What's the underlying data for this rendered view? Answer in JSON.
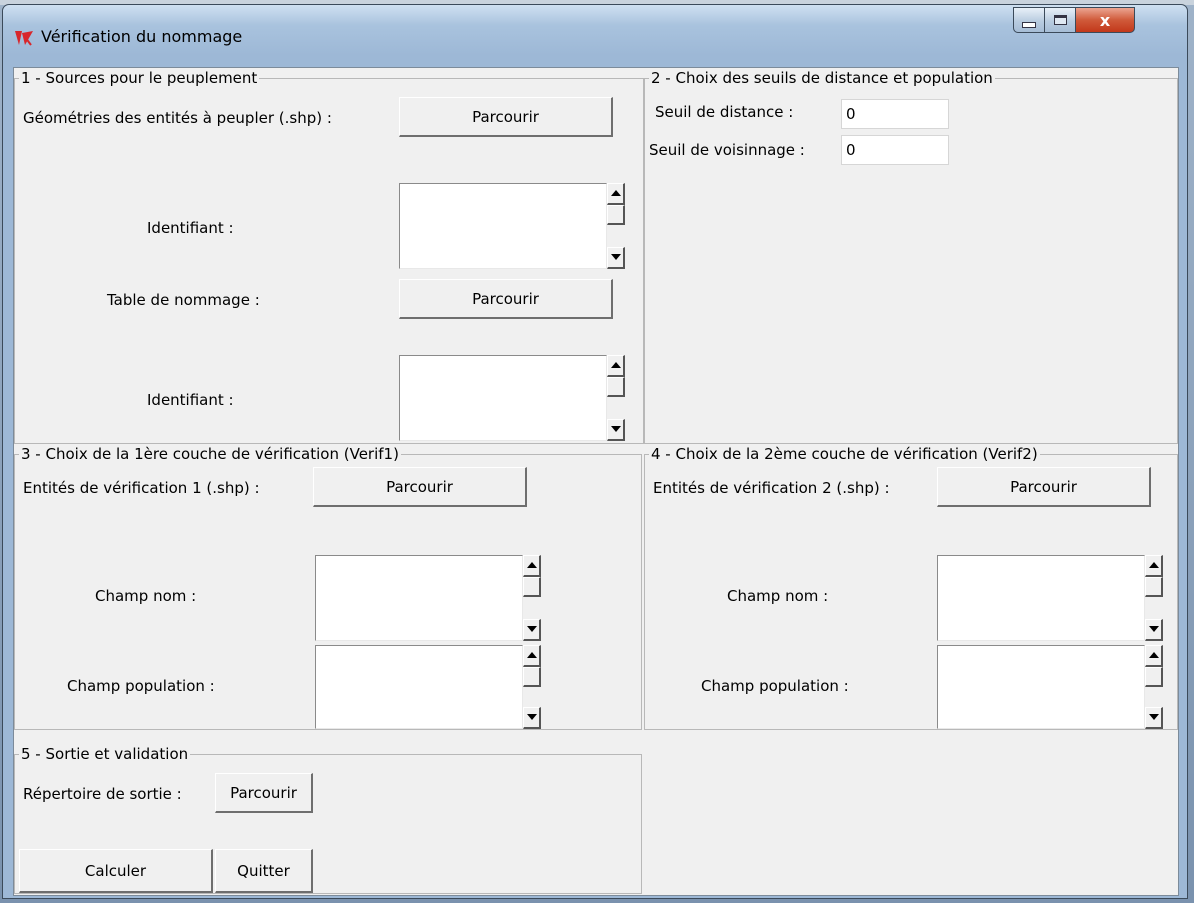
{
  "window": {
    "title": "Vérification du nommage",
    "close_glyph": "x"
  },
  "section1": {
    "title": "1 - Sources pour le peuplement",
    "geom_label": "Géométries des entités à peupler (.shp) :",
    "geom_button": "Parcourir",
    "identifiant1_label": "Identifiant :",
    "table_label": "Table de nommage :",
    "table_button": "Parcourir",
    "identifiant2_label": "Identifiant :"
  },
  "section2": {
    "title": "2 - Choix des seuils de distance et population",
    "distance_label": "Seuil de distance :",
    "distance_value": "0",
    "voisinage_label": "Seuil de voisinnage :",
    "voisinage_value": "0"
  },
  "section3": {
    "title": "3 - Choix de la 1ère couche de vérification (Verif1)",
    "entites_label": "Entités de vérification 1 (.shp) :",
    "entites_button": "Parcourir",
    "nom_label": "Champ nom :",
    "population_label": "Champ population :"
  },
  "section4": {
    "title": "4 - Choix de la 2ème couche de vérification (Verif2)",
    "entites_label": "Entités de vérification 2 (.shp) :",
    "entites_button": "Parcourir",
    "nom_label": "Champ nom :",
    "population_label": "Champ population :"
  },
  "section5": {
    "title": "5 - Sortie et validation",
    "sortie_label": "Répertoire de sortie :",
    "sortie_button": "Parcourir",
    "calculer_button": "Calculer",
    "quitter_button": "Quitter"
  },
  "colors": {
    "window_bg": "#f0f0f0",
    "close_button": "#c2381a",
    "titlebar": "#a9c3de"
  }
}
